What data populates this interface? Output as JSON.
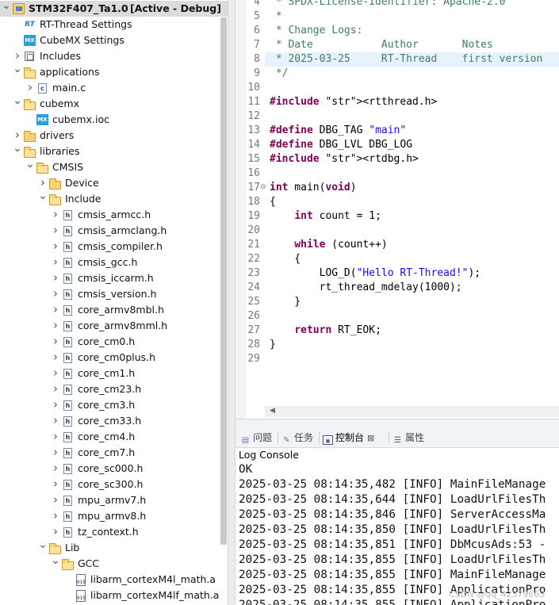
{
  "project_explorer": {
    "items": [
      {
        "label": "STM32F407_Ta1.0",
        "suffix": "[Active - Debug]"
      },
      {
        "label": "RT-Thread Settings"
      },
      {
        "label": "CubeMX Settings"
      },
      {
        "label": "Includes"
      },
      {
        "label": "applications"
      },
      {
        "label": "main.c"
      },
      {
        "label": "cubemx"
      },
      {
        "label": "cubemx.ioc"
      },
      {
        "label": "drivers"
      },
      {
        "label": "libraries"
      },
      {
        "label": "CMSIS"
      },
      {
        "label": "Device"
      },
      {
        "label": "Include"
      },
      {
        "label": "cmsis_armcc.h"
      },
      {
        "label": "cmsis_armclang.h"
      },
      {
        "label": "cmsis_compiler.h"
      },
      {
        "label": "cmsis_gcc.h"
      },
      {
        "label": "cmsis_iccarm.h"
      },
      {
        "label": "cmsis_version.h"
      },
      {
        "label": "core_armv8mbl.h"
      },
      {
        "label": "core_armv8mml.h"
      },
      {
        "label": "core_cm0.h"
      },
      {
        "label": "core_cm0plus.h"
      },
      {
        "label": "core_cm1.h"
      },
      {
        "label": "core_cm23.h"
      },
      {
        "label": "core_cm3.h"
      },
      {
        "label": "core_cm33.h"
      },
      {
        "label": "core_cm4.h"
      },
      {
        "label": "core_cm7.h"
      },
      {
        "label": "core_sc000.h"
      },
      {
        "label": "core_sc300.h"
      },
      {
        "label": "mpu_armv7.h"
      },
      {
        "label": "mpu_armv8.h"
      },
      {
        "label": "tz_context.h"
      },
      {
        "label": "Lib"
      },
      {
        "label": "GCC"
      },
      {
        "label": "libarm_cortexM4l_math.a"
      },
      {
        "label": "libarm_cortexM4lf_math.a"
      }
    ]
  },
  "editor": {
    "line_numbers": [
      "4",
      "5",
      "6",
      "7",
      "8",
      "9",
      "10",
      "11",
      "12",
      "13",
      "14",
      "15",
      "16",
      "17",
      "18",
      "19",
      "20",
      "21",
      "22",
      "23",
      "24",
      "25",
      "26",
      "27",
      "28",
      "29"
    ],
    "lines": [
      " * SPDX-License-Identifier: Apache-2.0",
      " *",
      " * Change Logs:",
      " * Date           Author       Notes",
      " * 2025-03-25     RT-Thread    first version",
      " */",
      "",
      "#include <rtthread.h>",
      "",
      "#define DBG_TAG \"main\"",
      "#define DBG_LVL DBG_LOG",
      "#include <rtdbg.h>",
      "",
      "int main(void)",
      "{",
      "    int count = 1;",
      "",
      "    while (count++)",
      "    {",
      "        LOG_D(\"Hello RT-Thread!\");",
      "        rt_thread_mdelay(1000);",
      "    }",
      "",
      "    return RT_EOK;",
      "}",
      ""
    ]
  },
  "panel": {
    "tabs": [
      {
        "label": "问题",
        "icon": "problems-icon"
      },
      {
        "label": "任务",
        "icon": "tasks-icon"
      },
      {
        "label": "控制台",
        "icon": "console-icon"
      },
      {
        "label": "属性",
        "icon": "properties-icon"
      }
    ],
    "console_title": "Log Console",
    "console_lines": [
      "OK",
      "2025-03-25 08:14:35,482 [INFO] MainFileManage",
      "2025-03-25 08:14:35,644 [INFO] LoadUrlFilesTh",
      "2025-03-25 08:14:35,846 [INFO] ServerAccessMa",
      "2025-03-25 08:14:35,850 [INFO] LoadUrlFilesTh",
      "2025-03-25 08:14:35,851 [INFO] DbMcusAds:53 -",
      "2025-03-25 08:14:35,855 [INFO] LoadUrlFilesTh",
      "2025-03-25 08:14:35,855 [INFO] MainFileManage",
      "2025-03-25 08:14:35,855 [INFO] ApplicationPro",
      "2025-03-25 08:14:35,855 [INFO] ApplicationPro"
    ]
  },
  "watermark": "CSDN @qq_42379663"
}
